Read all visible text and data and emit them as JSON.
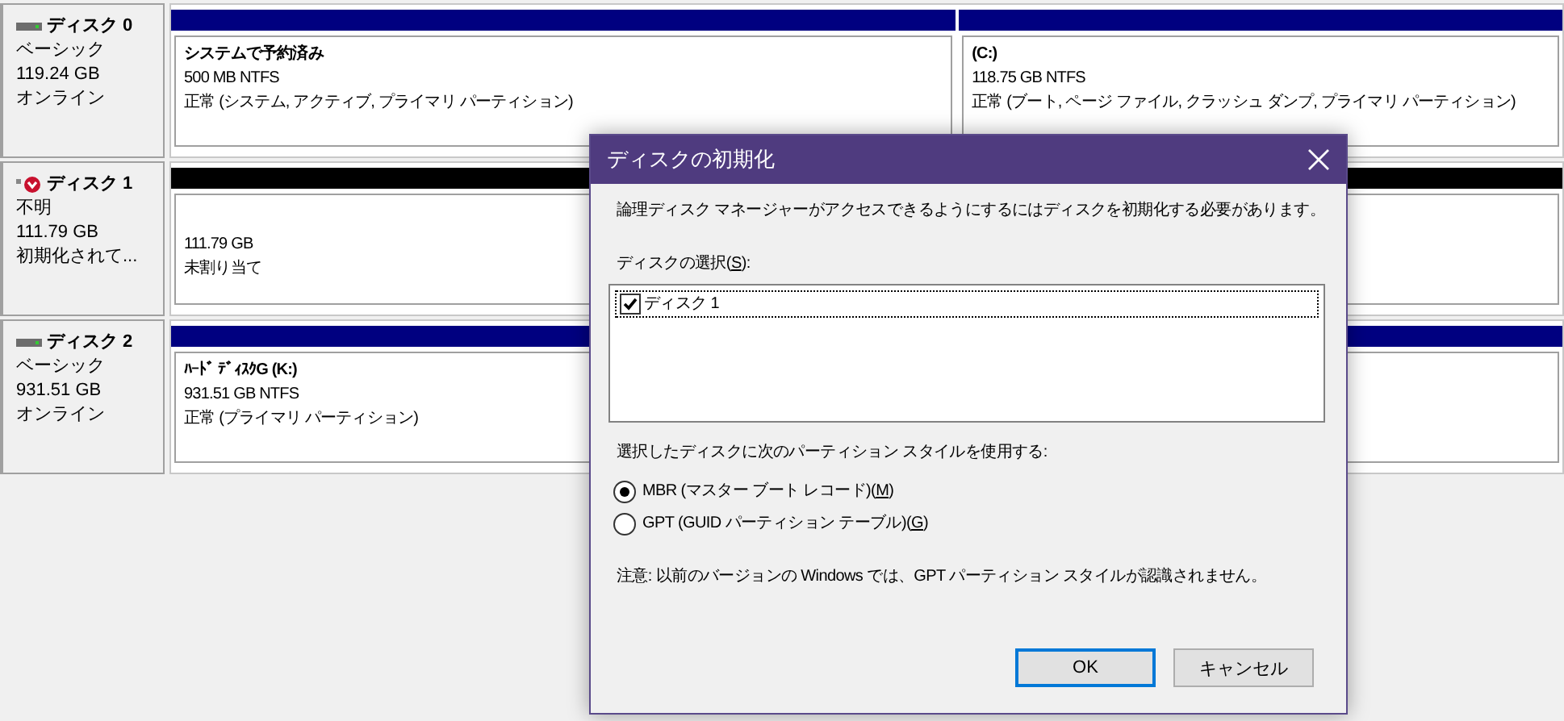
{
  "disks": [
    {
      "name": "ディスク 0",
      "type": "ベーシック",
      "size": "119.24 GB",
      "status": "オンライン",
      "alert": false,
      "partitions": [
        {
          "kind": "allocated",
          "title": "システムで予約済み",
          "size": "500 MB NTFS",
          "status": "正常 (システム, アクティブ, プライマリ パーティション)"
        },
        {
          "kind": "allocated",
          "title": "(C:)",
          "size": "118.75 GB NTFS",
          "status": "正常 (ブート, ページ ファイル, クラッシュ ダンプ, プライマリ パーティション)"
        }
      ]
    },
    {
      "name": "ディスク 1",
      "type": "不明",
      "size": "111.79 GB",
      "status": "初期化されて...",
      "alert": true,
      "partitions": [
        {
          "kind": "unallocated",
          "size": "111.79 GB",
          "status": "未割り当て"
        }
      ]
    },
    {
      "name": "ディスク 2",
      "type": "ベーシック",
      "size": "931.51 GB",
      "status": "オンライン",
      "alert": false,
      "partitions": [
        {
          "kind": "allocated",
          "title": "ﾊｰﾄﾞ ﾃﾞｨｽｸG  (K:)",
          "size": "931.51 GB NTFS",
          "status": "正常 (プライマリ パーティション)"
        }
      ]
    }
  ],
  "dialog": {
    "title": "ディスクの初期化",
    "message": "論理ディスク マネージャーがアクセスできるようにするにはディスクを初期化する必要があります。",
    "disk_list_label": {
      "before": "ディスクの選択(",
      "access_key": "S",
      "after": "):"
    },
    "disk_list": [
      {
        "label": "ディスク 1",
        "checked": true
      }
    ],
    "style_label": "選択したディスクに次のパーティション スタイルを使用する:",
    "styles": [
      {
        "before": "MBR (マスター ブート レコード)(",
        "access_key": "M",
        "after": ")",
        "selected": true
      },
      {
        "before": "GPT (GUID パーティション テーブル)(",
        "access_key": "G",
        "after": ")",
        "selected": false
      }
    ],
    "note": "注意: 以前のバージョンの Windows では、GPT パーティション スタイルが認識されません。",
    "buttons": [
      {
        "label": "OK",
        "default": true
      },
      {
        "label": "キャンセル",
        "default": false
      }
    ]
  }
}
